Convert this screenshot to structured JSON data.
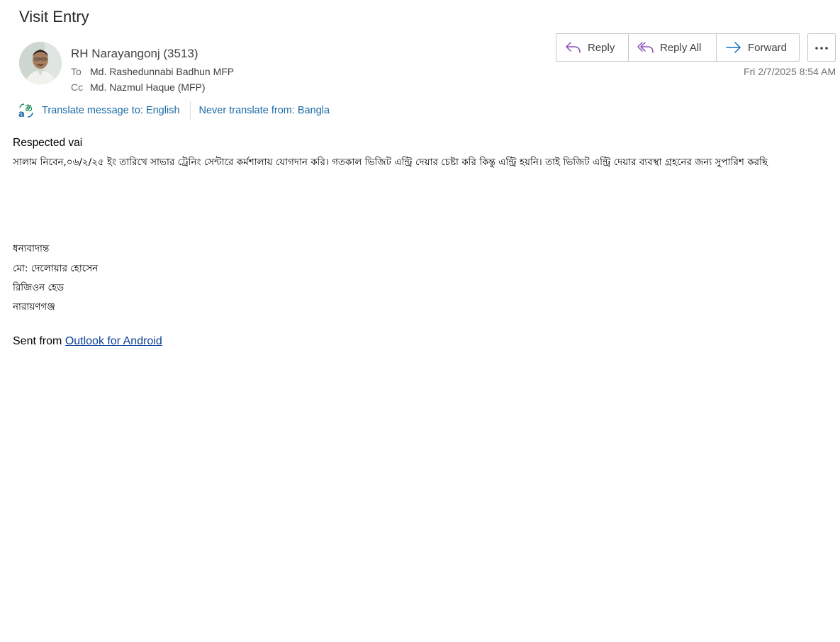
{
  "subject": "Visit Entry",
  "sender": {
    "name": "RH Narayangonj (3513)",
    "avatar": "profile-photo"
  },
  "recipients": {
    "to_label": "To",
    "to_value": "Md. Rashedunnabi Badhun MFP",
    "cc_label": "Cc",
    "cc_value": "Md. Nazmul Haque (MFP)"
  },
  "actions": {
    "reply": "Reply",
    "reply_all": "Reply All",
    "forward": "Forward",
    "more_icon": "more-horizontal-icon"
  },
  "timestamp": "Fri 2/7/2025 8:54 AM",
  "translate": {
    "icon": "translate-icon",
    "translate_link": "Translate message to: English",
    "never_link": "Never translate from: Bangla"
  },
  "body": {
    "greeting": "Respected vai",
    "paragraph": "সালাম নিবেন,০৬/২/২৫ ইং তারিখে সাভার ট্রেনিং সেন্টারে কর্মশালায় যোগদান করি। গতকাল ভিজিট এন্ট্রি দেয়ার চেষ্টা করি কিন্তু এন্ট্রি হয়নি।  তাই ভিজিট এন্ট্রি দেয়ার ব্যবস্থা গ্রহনের জন্য সুপারিশ করছি",
    "signature": [
      "ধন্যবাদান্ত",
      "মো: দেলোয়ার হোসেন",
      "রিজিওন হেড",
      "নারায়ণগঞ্জ"
    ],
    "sent_prefix": "Sent from ",
    "sent_link": "Outlook for Android"
  },
  "colors": {
    "reply_icon": "#8a4fb8",
    "forward_icon": "#0f6cbd",
    "link": "#1b6aa5",
    "translate_icon_green": "#1e8a5a",
    "translate_icon_blue": "#1b6aa5"
  }
}
